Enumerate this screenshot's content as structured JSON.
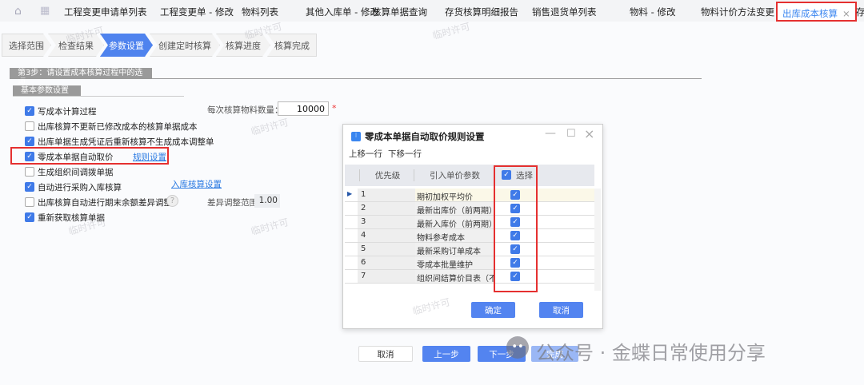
{
  "tabs": {
    "home_icon": "home-icon",
    "grid_icon": "grid-icon",
    "items": [
      "工程变更申请单列表",
      "工程变更单 - 修改",
      "物料列表",
      "其他入库单 - 修改",
      "核算单据查询",
      "存货核算明细报告",
      "销售退货单列表",
      "物料 - 修改",
      "物料计价方法变更"
    ],
    "active": "出库成本核算",
    "overflow": "存"
  },
  "steps": [
    "选择范围",
    "检查结果",
    "参数设置",
    "创建定时核算",
    "核算进度",
    "核算完成"
  ],
  "active_step": 2,
  "section_title": "第3步：请设置成本核算过程中的选项",
  "subsection_title": "基本参数设置",
  "options": [
    {
      "label": "写成本计算过程",
      "checked": true
    },
    {
      "label": "出库核算不更新已修改成本的核算单据成本",
      "checked": false
    },
    {
      "label": "出库单据生成凭证后重新核算不生成成本调整单",
      "checked": true
    },
    {
      "label": "零成本单据自动取价",
      "checked": true,
      "link": "规则设置"
    },
    {
      "label": "生成组织间调拨单据",
      "checked": false
    },
    {
      "label": "自动进行采购入库核算",
      "checked": true,
      "link": "入库核算设置"
    },
    {
      "label": "出库核算自动进行期末余额差异调整",
      "checked": false
    },
    {
      "label": "重新获取核算单据",
      "checked": true
    }
  ],
  "batch_qty": {
    "label": "每次核算物料数量：",
    "value": "10000",
    "required": "*"
  },
  "diff_range": {
    "label": "差异调整范围",
    "value": "1.00"
  },
  "dialog": {
    "title": "零成本单据自动取价规则设置",
    "move_up": "上移一行",
    "move_down": "下移一行",
    "columns": [
      "优先级",
      "引入单价参数",
      "选择"
    ],
    "rows": [
      {
        "priority": "1",
        "param": "期初加权平均价",
        "selected": true
      },
      {
        "priority": "2",
        "param": "最新出库价（前两期）",
        "selected": true
      },
      {
        "priority": "3",
        "param": "最新入库价（前两期）",
        "selected": true
      },
      {
        "priority": "4",
        "param": "物料参考成本",
        "selected": true
      },
      {
        "priority": "5",
        "param": "最新采购订单成本",
        "selected": true
      },
      {
        "priority": "6",
        "param": "零成本批量维护",
        "selected": true
      },
      {
        "priority": "7",
        "param": "组织间结算价目表（不支",
        "selected": true
      }
    ],
    "ok": "确定",
    "cancel": "取消"
  },
  "footer": {
    "cancel": "取消",
    "prev": "上一步",
    "next": "下一步",
    "finish": "完成"
  },
  "watermark": "临时许可",
  "wechat_watermark": "公众号 · 金蝶日常使用分享",
  "colors": {
    "accent": "#4f83ee",
    "highlight": "#e53030"
  }
}
